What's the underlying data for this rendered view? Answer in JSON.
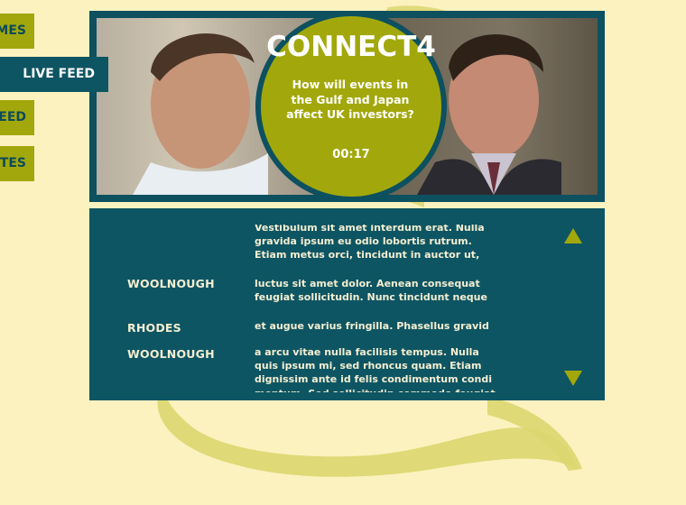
{
  "nav": {
    "items": [
      {
        "label": "MES"
      },
      {
        "label": "LIVE FEED"
      },
      {
        "label": "EED"
      },
      {
        "label": "TES"
      }
    ]
  },
  "video": {
    "title": "CONNECT4",
    "question": "How will events in the Gulf and Japan affect UK investors?",
    "timer": "00:17"
  },
  "transcript": {
    "entries": [
      {
        "speaker": "",
        "text": "Vestibulum sit amet interdum erat. Nulla\ngravida ipsum eu odio lobortis rutrum.\nEtiam metus orci, tincidunt in auctor ut,"
      },
      {
        "speaker": "WOOLNOUGH",
        "text": "luctus sit amet dolor. Aenean consequat\nfeugiat sollicitudin. Nunc tincidunt neque"
      },
      {
        "speaker": "RHODES",
        "text": "et augue varius fringilla. Phasellus gravid"
      },
      {
        "speaker": "WOOLNOUGH",
        "text": "a arcu vitae nulla facilisis tempus. Nulla\nquis ipsum mi, sed rhoncus quam. Etiam\ndignissim ante id felis condimentum condi\nmentum. Sed sollicitudin commodo feugiat."
      }
    ]
  },
  "colors": {
    "background": "#fbf2bf",
    "olive": "#a2a80b",
    "teal": "#0e5563",
    "swirl": "#dcd66f"
  }
}
